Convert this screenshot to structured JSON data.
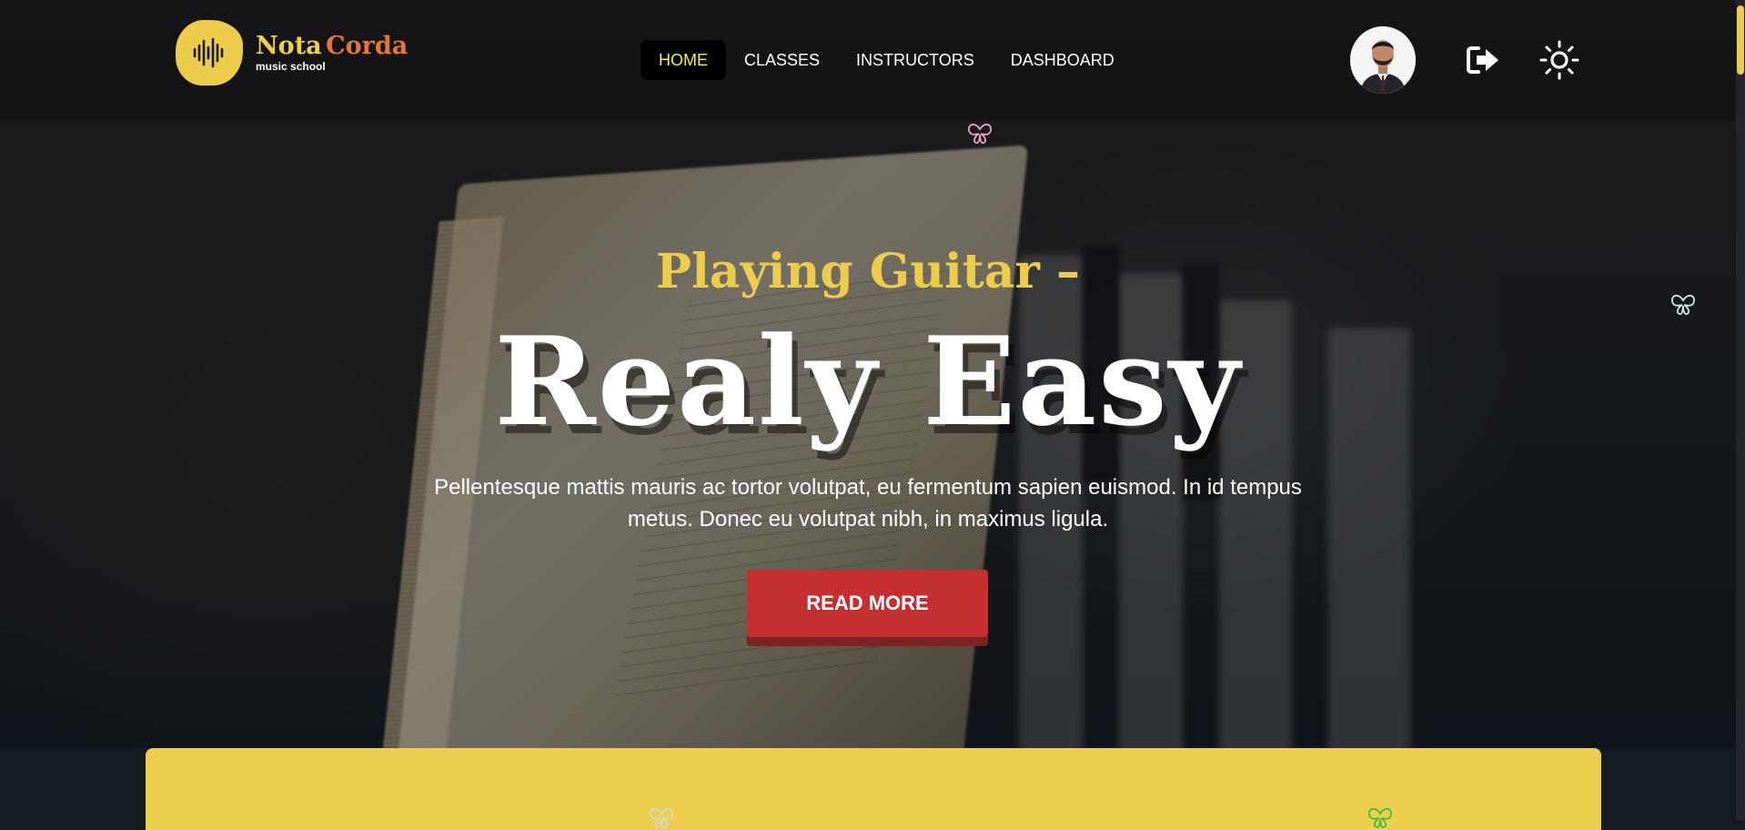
{
  "brand": {
    "name_part1": "Nota",
    "name_part2": "Corda",
    "tagline": "music school",
    "logo_icon": "soundwave-icon",
    "accent_color": "#eccc4b",
    "brand_orange": "#e4763a"
  },
  "nav": {
    "items": [
      {
        "label": "HOME",
        "active": true
      },
      {
        "label": "CLASSES",
        "active": false
      },
      {
        "label": "INSTRUCTORS",
        "active": false
      },
      {
        "label": "DASHBOARD",
        "active": false
      }
    ],
    "active_color": "#f7f04a"
  },
  "header_actions": {
    "avatar": "user-avatar",
    "logout_icon": "logout-icon",
    "theme_icon": "sun-icon"
  },
  "hero": {
    "eyebrow": "Playing Guitar –",
    "headline": "Realy Easy",
    "description": "Pellentesque mattis mauris ac tortor volutpat, eu fermentum sapien euismod. In id tempus metus. Donec eu volutpat nibh, in maximus ligula.",
    "cta_label": "READ MORE",
    "cta_color": "#c62f30"
  },
  "colors": {
    "panel_yellow": "#eccf4f",
    "header_bg": "#141416"
  }
}
